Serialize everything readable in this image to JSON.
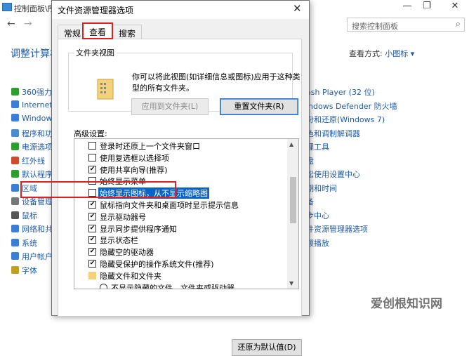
{
  "cp": {
    "title": "控制面板\\所",
    "search_placeholder": "搜索控制面板",
    "heading": "调整计算机",
    "view_by_label": "查看方式:",
    "view_by_value": "小图标 ▾",
    "left_items": [
      "360强力",
      "Internet",
      "Window",
      "程序和功",
      "电源选项",
      "红外线",
      "默认程序",
      "区域",
      "设备管理",
      "鼠标",
      "网络和共",
      "系统",
      "用户帐户",
      "字体"
    ],
    "right_items": [
      "ash Player (32 位)",
      "indows Defender 防火墙",
      "份和还原(Windows 7)",
      "色和调制解调器",
      "理工具",
      "盘",
      "松使用设置中心",
      "期和时间",
      "备",
      "步中心",
      "件资源管理器选项",
      "频播放"
    ]
  },
  "dialog": {
    "title": "文件资源管理器选项",
    "tabs": [
      "常规",
      "查看",
      "搜索"
    ],
    "group_label": "文件夹视图",
    "group_desc": "你可以将此视图(如详细信息或图标)应用于这种类型的所有文件夹。",
    "apply_button": "应用到文件夹(L)",
    "reset_button": "重置文件夹(R)",
    "advanced_label": "高级设置:",
    "settings": [
      {
        "label": "登录时还原上一个文件夹窗口",
        "checked": false
      },
      {
        "label": "使用复选框以选择项",
        "checked": false
      },
      {
        "label": "使用共享向导(推荐)",
        "checked": true
      },
      {
        "label": "始终显示菜单",
        "checked": false
      },
      {
        "label": "始终显示图标，从不显示缩略图",
        "checked": false,
        "highlight": true
      },
      {
        "label": "鼠标指向文件夹和桌面项时显示提示信息",
        "checked": true
      },
      {
        "label": "显示驱动器号",
        "checked": true
      },
      {
        "label": "显示同步提供程序通知",
        "checked": true
      },
      {
        "label": "显示状态栏",
        "checked": true
      },
      {
        "label": "隐藏空的驱动器",
        "checked": true
      },
      {
        "label": "隐藏受保护的操作系统文件(推荐)",
        "checked": true
      },
      {
        "label": "隐藏文件和文件夹",
        "folder": true
      },
      {
        "label": "不显示隐藏的文件、文件夹或驱动器",
        "radio": true
      }
    ],
    "restore_button": "还原为默认值(D)"
  },
  "watermark": "爱创根知识网",
  "colors": {
    "accent": "#1e5aa8",
    "highlight": "#e02020",
    "selection": "#0a64c8"
  }
}
